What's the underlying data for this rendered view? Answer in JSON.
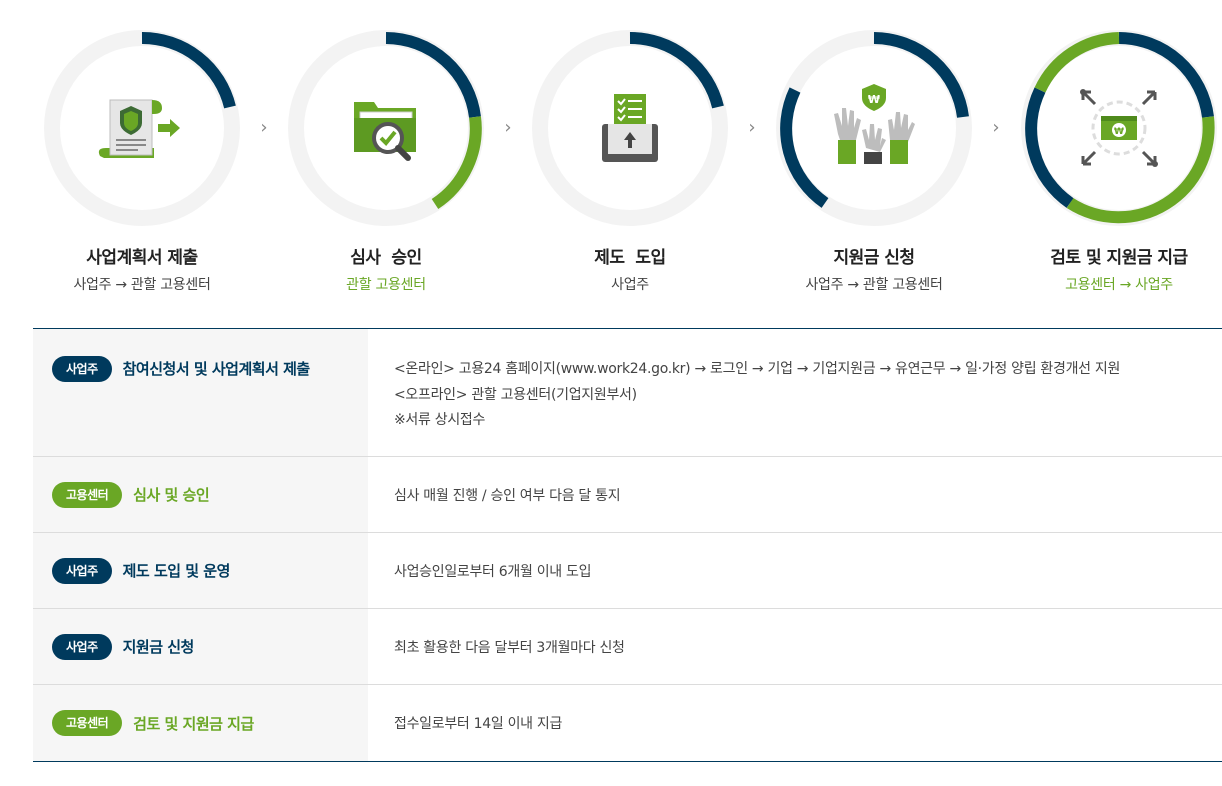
{
  "steps": [
    {
      "title": "사업계획서 제출",
      "sub": "사업주 → 관할 고용센터",
      "sub_color": "dark",
      "icon": "document-submit-icon",
      "ring": "navy-quarter"
    },
    {
      "title": "심사  승인",
      "sub": "관할 고용센터",
      "sub_color": "green",
      "icon": "folder-review-icon",
      "ring": "navy-green-half"
    },
    {
      "title": "제도  도입",
      "sub": "사업주",
      "sub_color": "dark",
      "icon": "checklist-upload-icon",
      "ring": "navy-quarter"
    },
    {
      "title": "지원금 신청",
      "sub": "사업주 → 관할 고용센터",
      "sub_color": "dark",
      "icon": "raised-hands-won-icon",
      "ring": "navy-wide"
    },
    {
      "title": "검토 및 지원금 지급",
      "sub": "고용센터 → 사업주",
      "sub_color": "green",
      "icon": "money-expand-icon",
      "ring": "full"
    }
  ],
  "step_arrows": [
    "›",
    "›",
    "›",
    "›"
  ],
  "table": {
    "rows": [
      {
        "badge": "사업주",
        "badge_color": "navy",
        "label": "참여신청서 및 사업계획서 제출",
        "lines": [
          "<온라인> 고용24 홈페이지(www.work24.go.kr) → 로그인 → 기업 → 기업지원금 → 유연근무 → 일·가정 양립 환경개선 지원",
          "<오프라인> 관할 고용센터(기업지원부서)",
          "※서류 상시접수"
        ]
      },
      {
        "badge": "고용센터",
        "badge_color": "green",
        "label": "심사 및 승인",
        "lines": [
          "심사 매월 진행 / 승인 여부 다음 달 통지"
        ]
      },
      {
        "badge": "사업주",
        "badge_color": "navy",
        "label": "제도 도입 및 운영",
        "lines": [
          "사업승인일로부터 6개월 이내 도입"
        ]
      },
      {
        "badge": "사업주",
        "badge_color": "navy",
        "label": "지원금 신청",
        "lines": [
          "최초 활용한 다음 달부터 3개월마다 신청"
        ]
      },
      {
        "badge": "고용센터",
        "badge_color": "green",
        "label": "검토 및 지원금 지급",
        "lines": [
          "접수일로부터 14일 이내 지급"
        ]
      }
    ]
  },
  "colors": {
    "navy": "#003a5d",
    "green": "#6aa725",
    "ring_bg": "#f3f3f3"
  }
}
